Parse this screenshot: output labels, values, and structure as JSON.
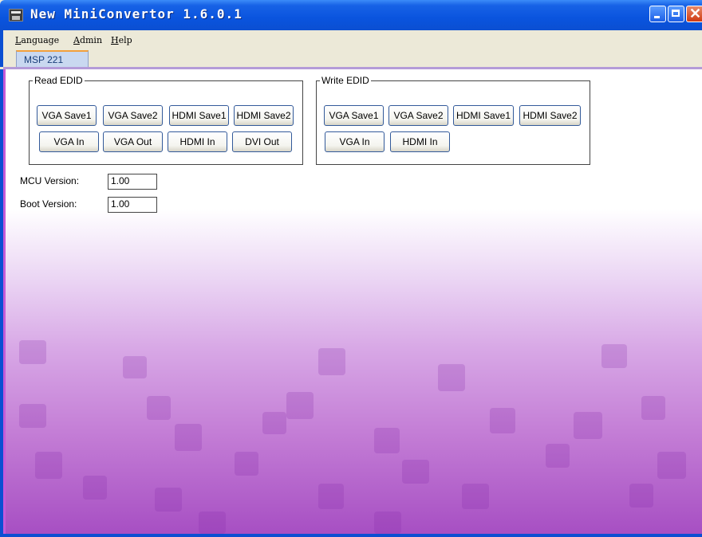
{
  "window": {
    "title": "New MiniConvertor 1.6.0.1"
  },
  "menu": {
    "items": [
      {
        "first": "L",
        "rest": "anguage"
      },
      {
        "first": "A",
        "rest": "dmin"
      },
      {
        "first": "H",
        "rest": "elp"
      }
    ]
  },
  "tabs": [
    {
      "label": "MSP 221"
    }
  ],
  "read_edid": {
    "label": "Read EDID",
    "buttons": [
      "VGA Save1",
      "VGA Save2",
      "HDMI Save1",
      "HDMI Save2",
      "VGA In",
      "VGA Out",
      "HDMI In",
      "DVI Out"
    ]
  },
  "write_edid": {
    "label": "Write EDID",
    "buttons": [
      "VGA Save1",
      "VGA Save2",
      "HDMI Save1",
      "HDMI Save2",
      "VGA In",
      "HDMI In"
    ]
  },
  "fields": {
    "mcu_version": {
      "label": "MCU Version:",
      "value": "1.00"
    },
    "boot_version": {
      "label": "Boot Version:",
      "value": "1.00"
    }
  },
  "colors": {
    "titlebar": "#0b4fd2",
    "background_gradient_end": "#a74fc3",
    "tab_accent": "#f2a03c"
  },
  "icons": {
    "app": "app-icon",
    "minimize": "minimize-icon",
    "maximize": "maximize-icon",
    "close": "close-icon"
  }
}
